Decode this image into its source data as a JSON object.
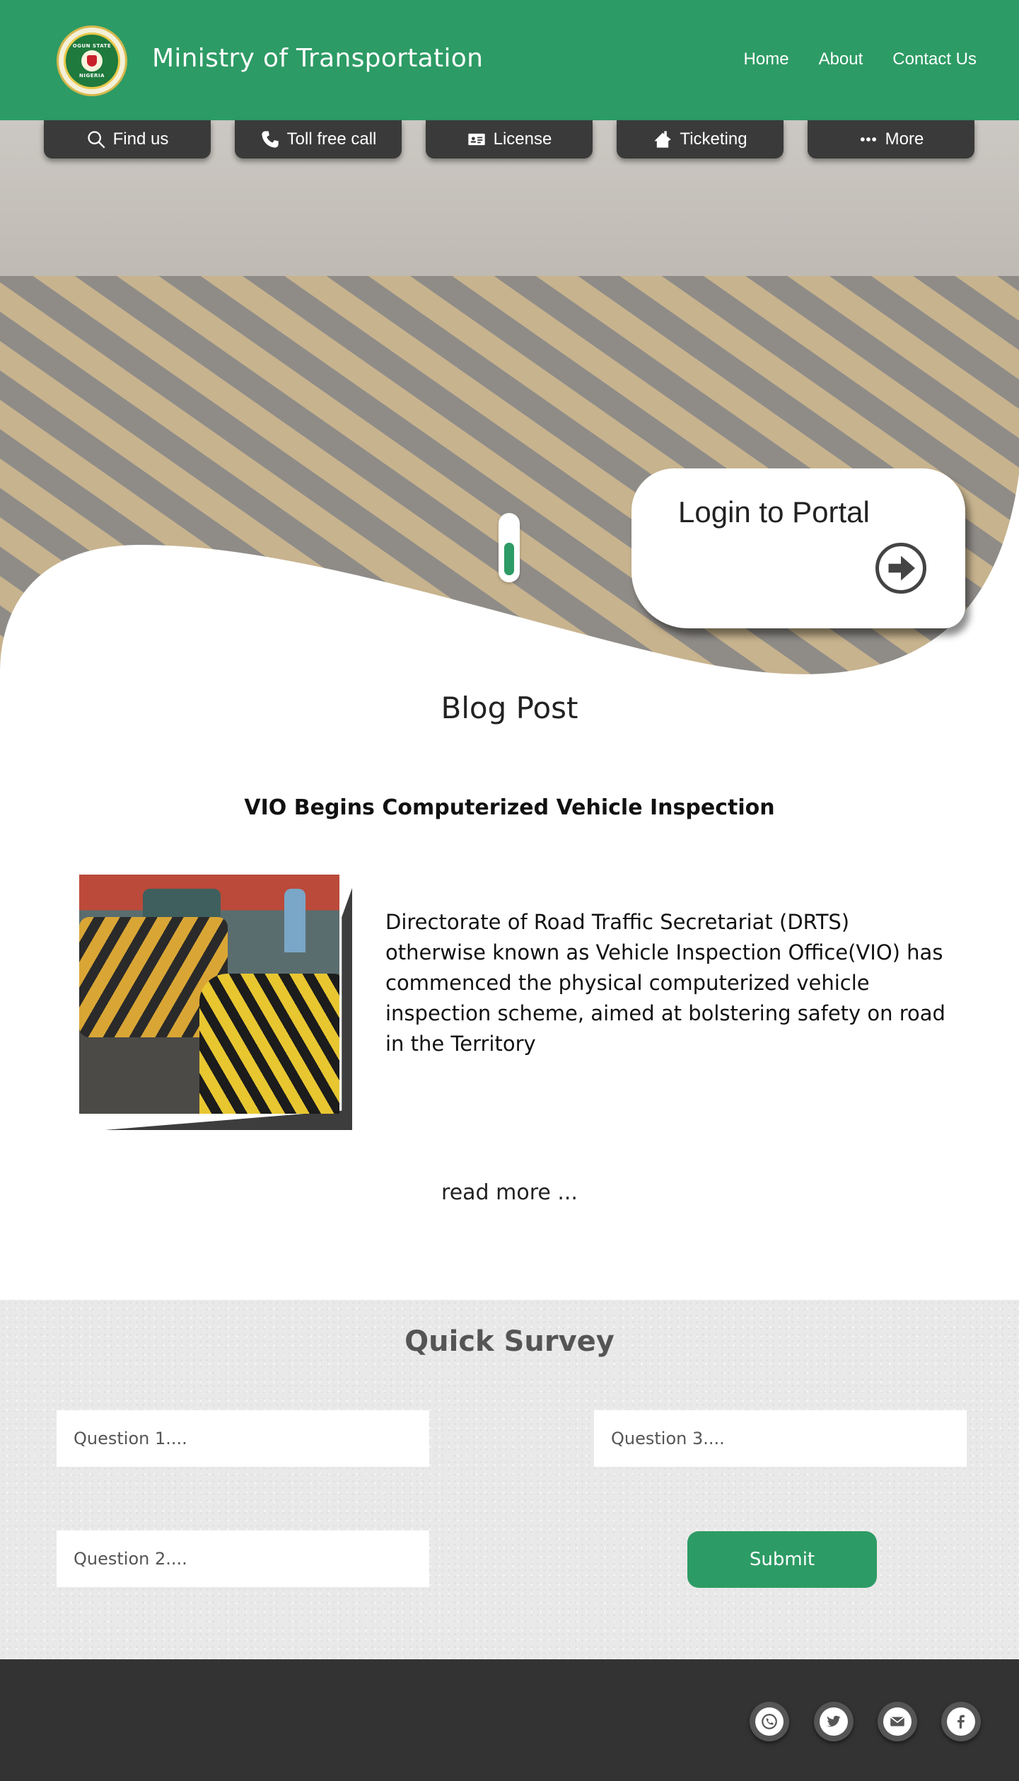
{
  "header": {
    "logo_alt": "OGUN STATE NIGERIA",
    "logo_top": "OGUN STATE",
    "logo_bottom": "NIGERIA",
    "title": "Ministry of Transportation",
    "nav": [
      "Home",
      "About",
      "Contact Us"
    ]
  },
  "quick_links": [
    {
      "label": "Find us",
      "icon": "search-icon"
    },
    {
      "label": "Toll free call",
      "icon": "phone-icon"
    },
    {
      "label": "License",
      "icon": "id-card-icon"
    },
    {
      "label": "Ticketing",
      "icon": "ticket-icon"
    },
    {
      "label": "More",
      "icon": "more-dots-icon"
    }
  ],
  "hero": {
    "login_title": "Login to Portal",
    "login_icon": "arrow-right-circle-icon"
  },
  "blog": {
    "section_title": "Blog Post",
    "post_title": "VIO Begins Computerized Vehicle Inspection",
    "post_text": "Directorate of Road Traffic Secretariat (DRTS) otherwise known as Vehicle Inspection Office(VIO) has commenced the physical computerized vehicle inspection scheme, aimed at bolstering safety on road in the Territory",
    "read_more": "read more ..."
  },
  "survey": {
    "title": "Quick Survey",
    "q1_placeholder": "Question 1....",
    "q2_placeholder": "Question 2....",
    "q3_placeholder": "Question 3....",
    "submit_label": "Submit"
  },
  "footer": {
    "social": [
      "whatsapp-icon",
      "twitter-icon",
      "email-icon",
      "facebook-icon"
    ]
  },
  "colors": {
    "brand_green": "#2d9b65",
    "dark_bar": "#3a3a3a",
    "footer": "#333333"
  }
}
